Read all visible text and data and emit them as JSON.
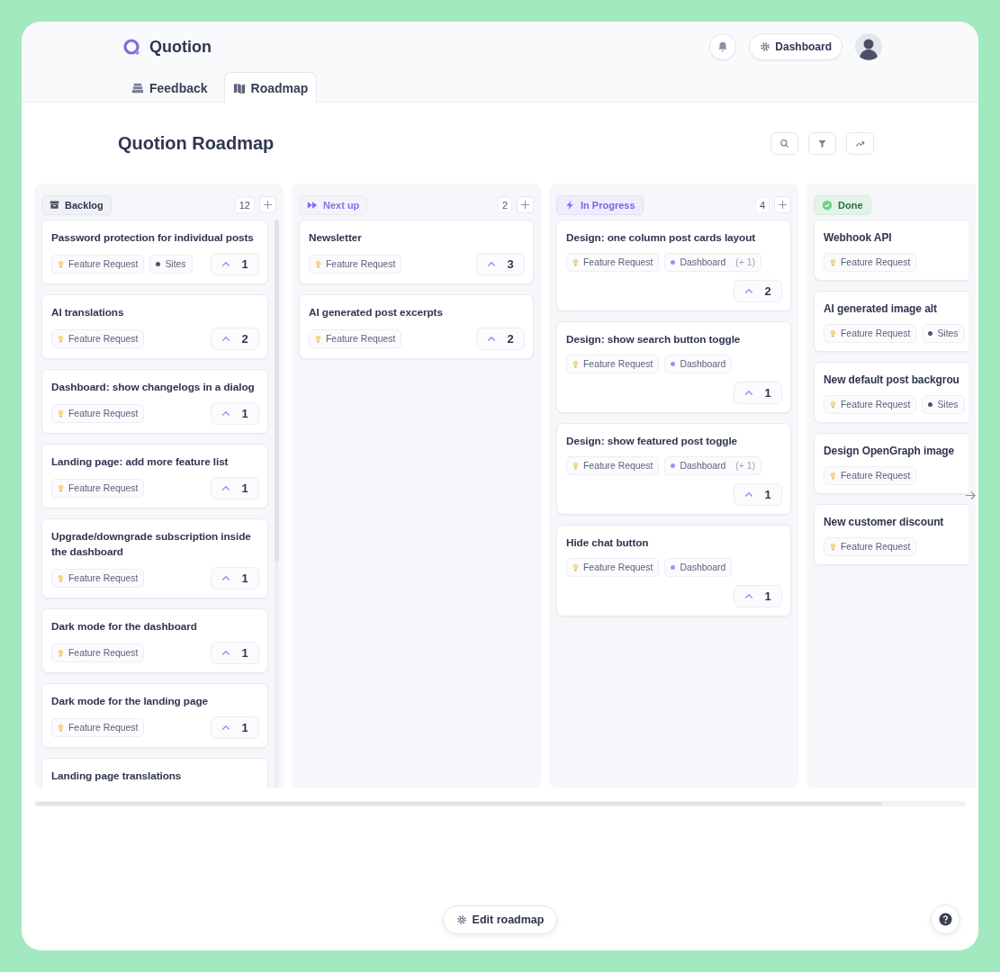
{
  "app": {
    "name": "Quotion"
  },
  "header": {
    "dashboard_button": "Dashboard"
  },
  "tabs": [
    {
      "label": "Feedback",
      "kind": "feedback",
      "selected": false
    },
    {
      "label": "Roadmap",
      "kind": "roadmap",
      "selected": true
    }
  ],
  "page_title": "Quotion Roadmap",
  "columns": [
    {
      "kind": "backlog",
      "title": "Backlog",
      "count": "12",
      "scrollable": true,
      "cards": [
        {
          "title": "Password protection for individual posts",
          "tags": [
            {
              "kind": "category",
              "label": "Feature Request"
            },
            {
              "kind": "label",
              "label": "Sites",
              "color": "#475569"
            }
          ],
          "votes": "1"
        },
        {
          "title": "AI translations",
          "tags": [
            {
              "kind": "category",
              "label": "Feature Request"
            }
          ],
          "votes": "2"
        },
        {
          "title": "Dashboard: show changelogs in a dialog",
          "tags": [
            {
              "kind": "category",
              "label": "Feature Request"
            }
          ],
          "votes": "1"
        },
        {
          "title": "Landing page: add more feature list",
          "tags": [
            {
              "kind": "category",
              "label": "Feature Request"
            }
          ],
          "votes": "1"
        },
        {
          "title": "Upgrade/downgrade subscription inside the dashboard",
          "tags": [
            {
              "kind": "category",
              "label": "Feature Request"
            }
          ],
          "votes": "1"
        },
        {
          "title": "Dark mode for the dashboard",
          "tags": [
            {
              "kind": "category",
              "label": "Feature Request"
            }
          ],
          "votes": "1"
        },
        {
          "title": "Dark mode for the landing page",
          "tags": [
            {
              "kind": "category",
              "label": "Feature Request"
            }
          ],
          "votes": "1"
        },
        {
          "title": "Landing page translations"
        }
      ]
    },
    {
      "kind": "next",
      "title": "Next up",
      "count": "2",
      "scrollable": false,
      "cards": [
        {
          "title": "Newsletter",
          "tags": [
            {
              "kind": "category",
              "label": "Feature Request"
            }
          ],
          "votes": "3"
        },
        {
          "title": "AI generated post excerpts",
          "tags": [
            {
              "kind": "category",
              "label": "Feature Request"
            }
          ],
          "votes": "2"
        }
      ]
    },
    {
      "kind": "progress",
      "title": "In Progress",
      "count": "4",
      "scrollable": false,
      "cards": [
        {
          "title": "Design: one column post cards layout",
          "tags": [
            {
              "kind": "category",
              "label": "Feature Request"
            },
            {
              "kind": "label",
              "label": "Dashboard",
              "color": "#a78bfa",
              "more": "(+ 1)"
            }
          ],
          "votes": "2"
        },
        {
          "title": "Design: show search button toggle",
          "tags": [
            {
              "kind": "category",
              "label": "Feature Request"
            },
            {
              "kind": "label",
              "label": "Dashboard",
              "color": "#a78bfa"
            }
          ],
          "votes": "1"
        },
        {
          "title": "Design: show featured post toggle",
          "tags": [
            {
              "kind": "category",
              "label": "Feature Request"
            },
            {
              "kind": "label",
              "label": "Dashboard",
              "color": "#a78bfa",
              "more": "(+ 1)"
            }
          ],
          "votes": "1"
        },
        {
          "title": "Hide chat button",
          "tags": [
            {
              "kind": "category",
              "label": "Feature Request"
            },
            {
              "kind": "label",
              "label": "Dashboard",
              "color": "#a78bfa"
            }
          ],
          "votes": "1"
        }
      ]
    },
    {
      "kind": "done",
      "title": "Done",
      "scrollable": false,
      "cards": [
        {
          "title": "Webhook API",
          "tags": [
            {
              "kind": "category",
              "label": "Feature Request"
            }
          ]
        },
        {
          "title": "AI generated image alt",
          "tags": [
            {
              "kind": "category",
              "label": "Feature Request"
            },
            {
              "kind": "label",
              "label": "Sites",
              "color": "#475569"
            }
          ]
        },
        {
          "title": "New default post backgrou",
          "tags": [
            {
              "kind": "category",
              "label": "Feature Request"
            },
            {
              "kind": "label",
              "label": "Sites",
              "color": "#475569"
            }
          ]
        },
        {
          "title": "Design OpenGraph image",
          "tags": [
            {
              "kind": "category",
              "label": "Feature Request"
            }
          ]
        },
        {
          "title": "New customer discount",
          "tags": [
            {
              "kind": "category",
              "label": "Feature Request"
            }
          ]
        }
      ]
    }
  ],
  "edit_button": "Edit roadmap"
}
